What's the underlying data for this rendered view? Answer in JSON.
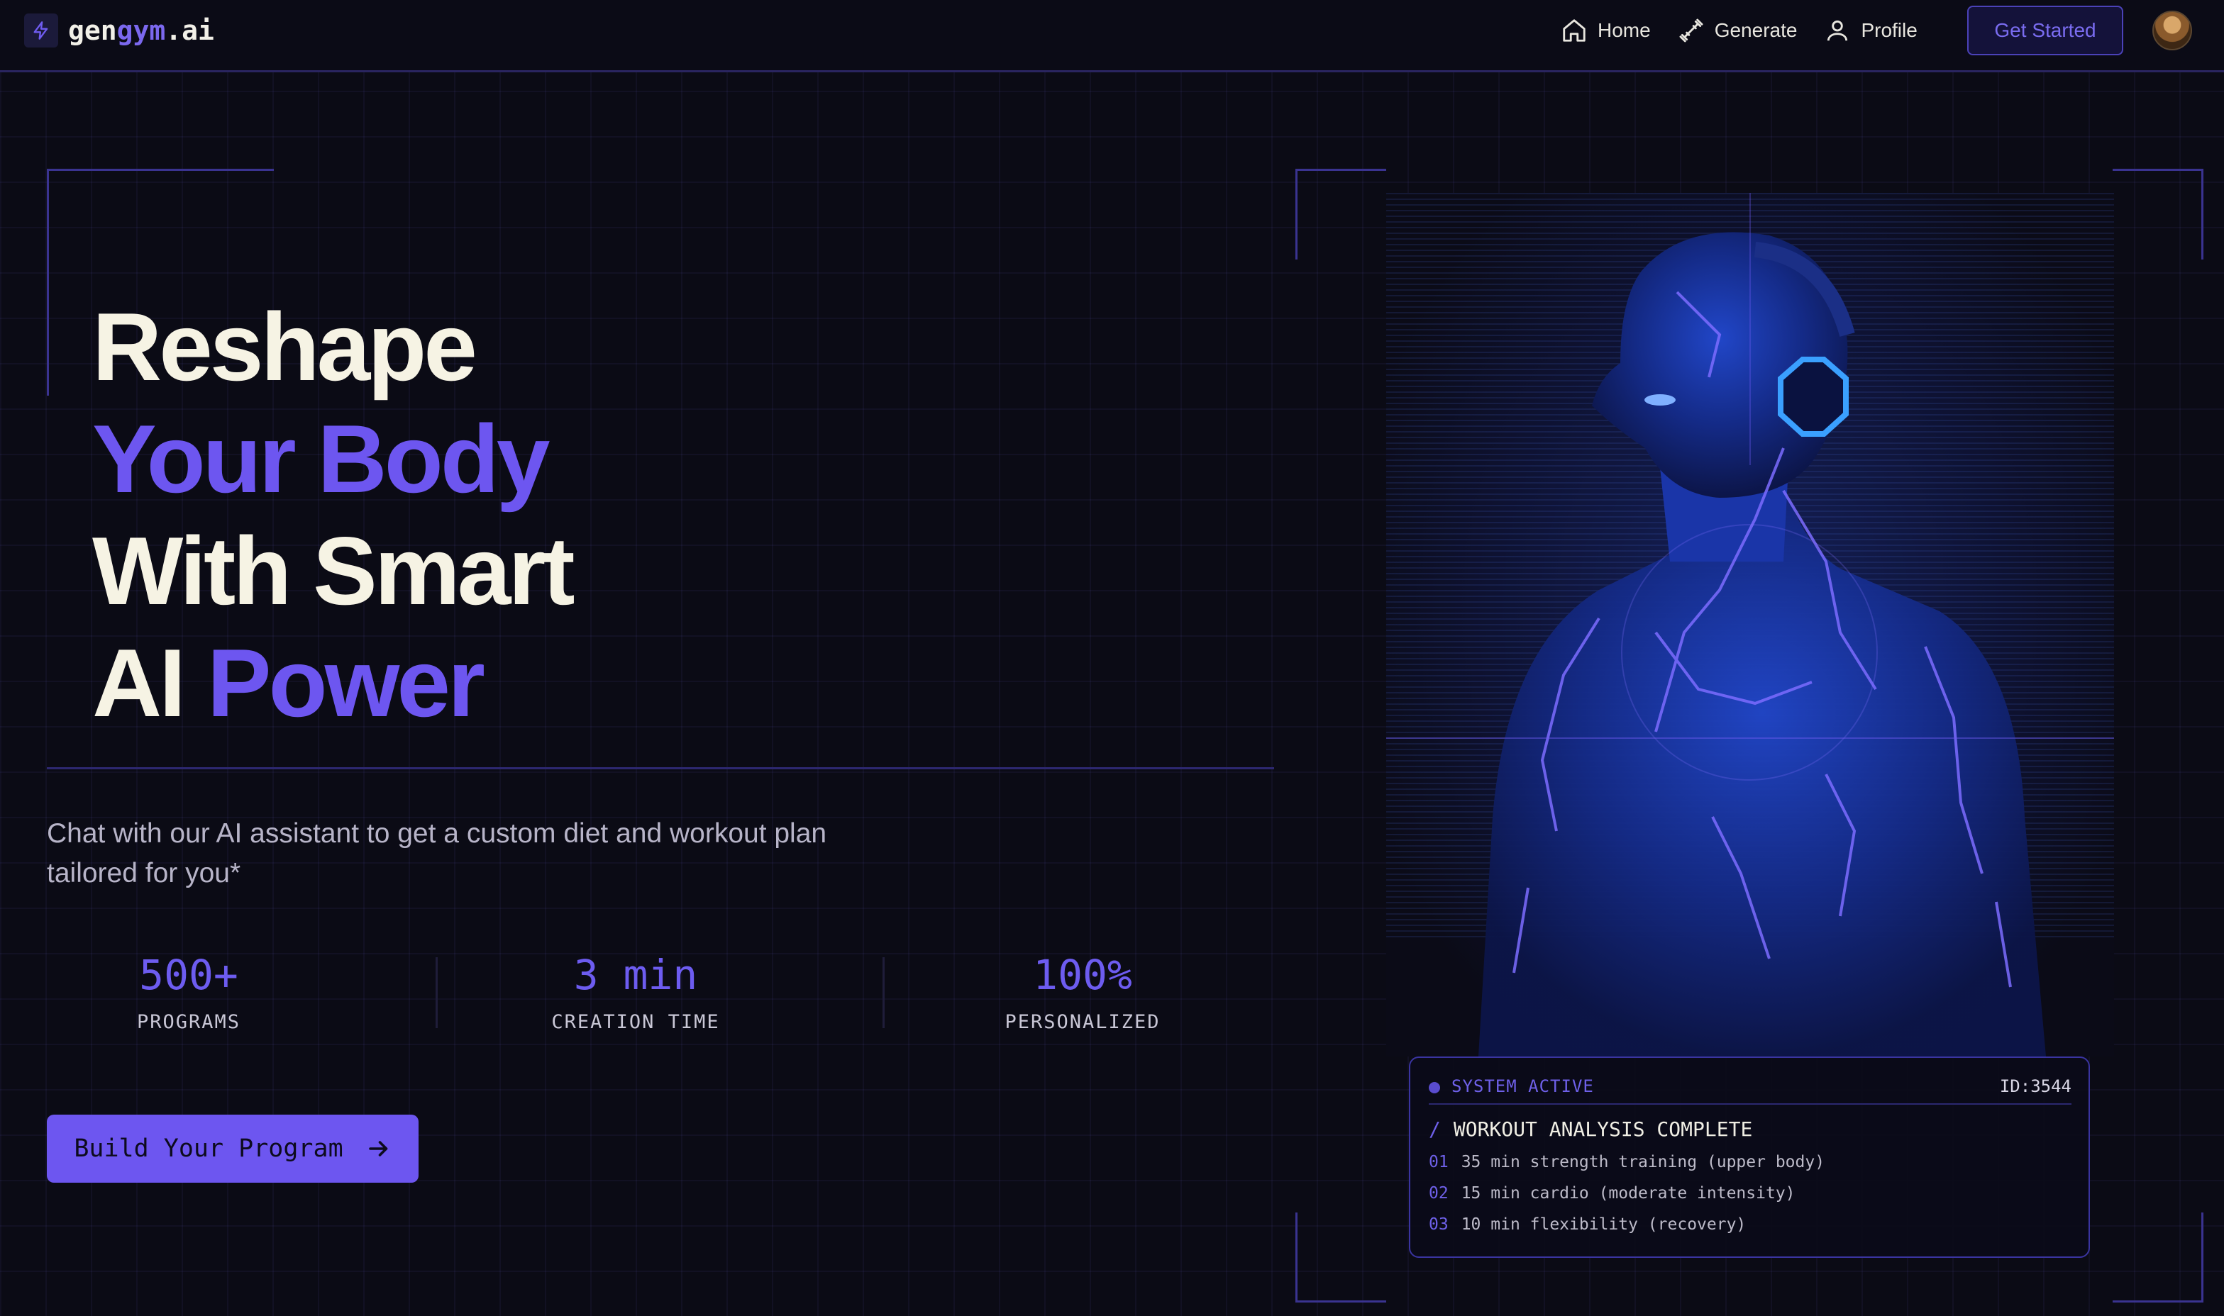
{
  "nav": {
    "logo": {
      "part1": "gen",
      "part2": "gym",
      "part3": ".ai"
    },
    "links": [
      {
        "label": "Home",
        "icon": "home-icon"
      },
      {
        "label": "Generate",
        "icon": "dumbbell-icon"
      },
      {
        "label": "Profile",
        "icon": "user-icon"
      }
    ],
    "cta_label": "Get Started"
  },
  "hero": {
    "line1": "Reshape",
    "line2": "Your Body",
    "line3": "With Smart",
    "line4_white": "AI",
    "line4_purple": "Power",
    "subtitle": "Chat with our AI assistant to get a custom diet and workout plan tailored for you*",
    "stats": [
      {
        "value": "500+",
        "label": "PROGRAMS"
      },
      {
        "value": "3 min",
        "label": "CREATION TIME"
      },
      {
        "value": "100%",
        "label": "PERSONALIZED"
      }
    ],
    "cta_label": "Build Your Program"
  },
  "status": {
    "state": "SYSTEM ACTIVE",
    "id": "ID:3544",
    "title": "WORKOUT ANALYSIS COMPLETE",
    "items": [
      {
        "num": "01",
        "text": "35 min strength training (upper body)"
      },
      {
        "num": "02",
        "text": "15 min cardio (moderate intensity)"
      },
      {
        "num": "03",
        "text": "10 min flexibility (recovery)"
      }
    ]
  },
  "colors": {
    "accent": "#6d56f0",
    "background": "#0b0b15",
    "text": "#f6f3e4"
  }
}
